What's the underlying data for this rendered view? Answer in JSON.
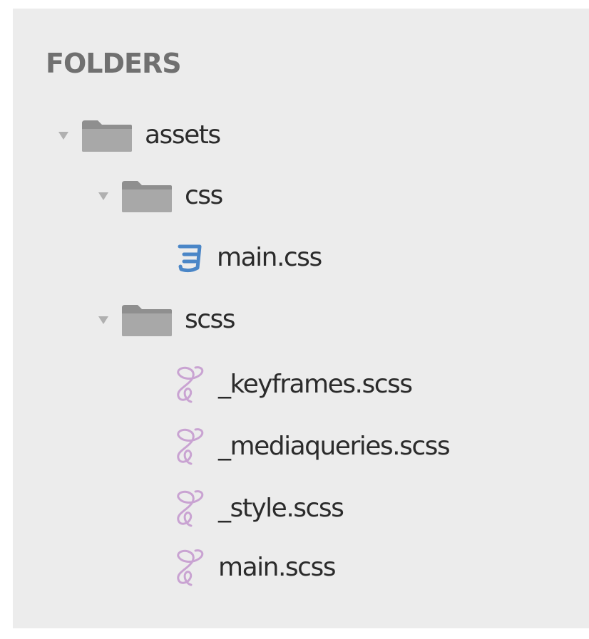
{
  "sidebar": {
    "heading": "FOLDERS",
    "tree": {
      "assets": {
        "name": "assets",
        "expanded": true,
        "icon": "folder-icon"
      },
      "css": {
        "name": "css",
        "expanded": true,
        "icon": "folder-icon"
      },
      "main_css": {
        "name": "main.css",
        "icon": "css3-file-icon",
        "icon_color": "#4a86c7"
      },
      "scss": {
        "name": "scss",
        "expanded": true,
        "icon": "folder-icon"
      },
      "keyframes": {
        "name": "_keyframes.scss",
        "icon": "sass-file-icon",
        "icon_color": "#c9a3d2"
      },
      "mediaqueries": {
        "name": "_mediaqueries.scss",
        "icon": "sass-file-icon",
        "icon_color": "#c9a3d2"
      },
      "style": {
        "name": "_style.scss",
        "icon": "sass-file-icon",
        "icon_color": "#c9a3d2"
      },
      "main_scss": {
        "name": "main.scss",
        "icon": "sass-file-icon",
        "icon_color": "#c9a3d2"
      }
    }
  }
}
